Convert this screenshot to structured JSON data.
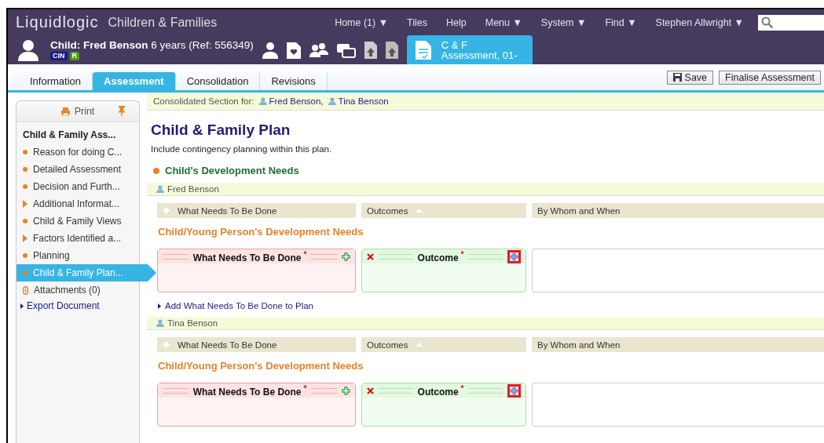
{
  "app": {
    "logo": "Liquidlogic",
    "title": "Children & Families"
  },
  "nav": [
    {
      "label": "Home (1) ▼"
    },
    {
      "label": "Tiles"
    },
    {
      "label": "Help"
    },
    {
      "label": "Menu ▼"
    },
    {
      "label": "System ▼"
    },
    {
      "label": "Find ▼"
    },
    {
      "label": "Stephen Allwright ▼"
    }
  ],
  "record": {
    "name": "Child: Fred Benson",
    "detail": "6 years (Ref: 556349)",
    "badges": [
      {
        "text": "CIN",
        "color": "#1a1a8c"
      },
      {
        "text": "R",
        "color": "#4e9a1c"
      }
    ],
    "open_tab": {
      "line1": "C & F",
      "line2": "Assessment, 01-"
    }
  },
  "tabs": [
    {
      "label": "Information",
      "selected": false
    },
    {
      "label": "Assessment",
      "selected": true
    },
    {
      "label": "Consolidation",
      "selected": false
    },
    {
      "label": "Revisions",
      "selected": false
    }
  ],
  "buttons": [
    {
      "label": "Save",
      "kind": "save"
    },
    {
      "label": "Finalise Assessment",
      "kind": "plain"
    }
  ],
  "sidebar": {
    "print": "Print",
    "items": [
      {
        "label": "Child & Family Ass...",
        "kind": "header",
        "selected": false
      },
      {
        "label": "Reason for doing C...",
        "kind": "bullet",
        "selected": false
      },
      {
        "label": "Detailed Assessment",
        "kind": "bullet",
        "selected": false
      },
      {
        "label": "Decision and Furth...",
        "kind": "bullet",
        "selected": false
      },
      {
        "label": "Additional Informat...",
        "kind": "arrow",
        "selected": false
      },
      {
        "label": "Child & Family Views",
        "kind": "bullet",
        "selected": false
      },
      {
        "label": "Factors Identified a...",
        "kind": "arrow",
        "selected": false
      },
      {
        "label": "Planning",
        "kind": "bullet",
        "selected": false
      },
      {
        "label": "Child & Family Plan...",
        "kind": "bullet",
        "selected": true
      },
      {
        "label": "Attachments (0)",
        "kind": "attachment",
        "selected": false
      },
      {
        "label": "Export Document",
        "kind": "link",
        "selected": false
      }
    ]
  },
  "consolidated": {
    "label": "Consolidated Section for:",
    "people": [
      "Fred Benson,",
      "Tina Benson"
    ]
  },
  "heading": "Child & Family Plan",
  "intro": "Include contingency planning within this plan.",
  "section": "Child's Development Needs",
  "persons": [
    {
      "name": "Fred Benson",
      "columns": [
        {
          "label": "What Needs To Be Done",
          "sorted": false
        },
        {
          "label": "Outcomes",
          "sorted": true
        },
        {
          "label": "By Whom and When",
          "sorted": false
        }
      ],
      "subheading": "Child/Young Person's Development Needs",
      "need": "What Needs To Be Done",
      "need_mark": "*",
      "outcome": "Outcome",
      "outcome_mark": "*",
      "highlighted": true,
      "add_link": "Add What Needs To Be Done to Plan"
    },
    {
      "name": "Tina Benson",
      "columns": [
        {
          "label": "What Needs To Be Done",
          "sorted": false
        },
        {
          "label": "Outcomes",
          "sorted": true
        },
        {
          "label": "By Whom and When",
          "sorted": false
        }
      ],
      "subheading": "Child/Young Person's Development Needs",
      "need": "What Needs To Be Done",
      "need_mark": "*",
      "outcome": "Outcome",
      "outcome_mark": "*",
      "highlighted": true
    }
  ]
}
